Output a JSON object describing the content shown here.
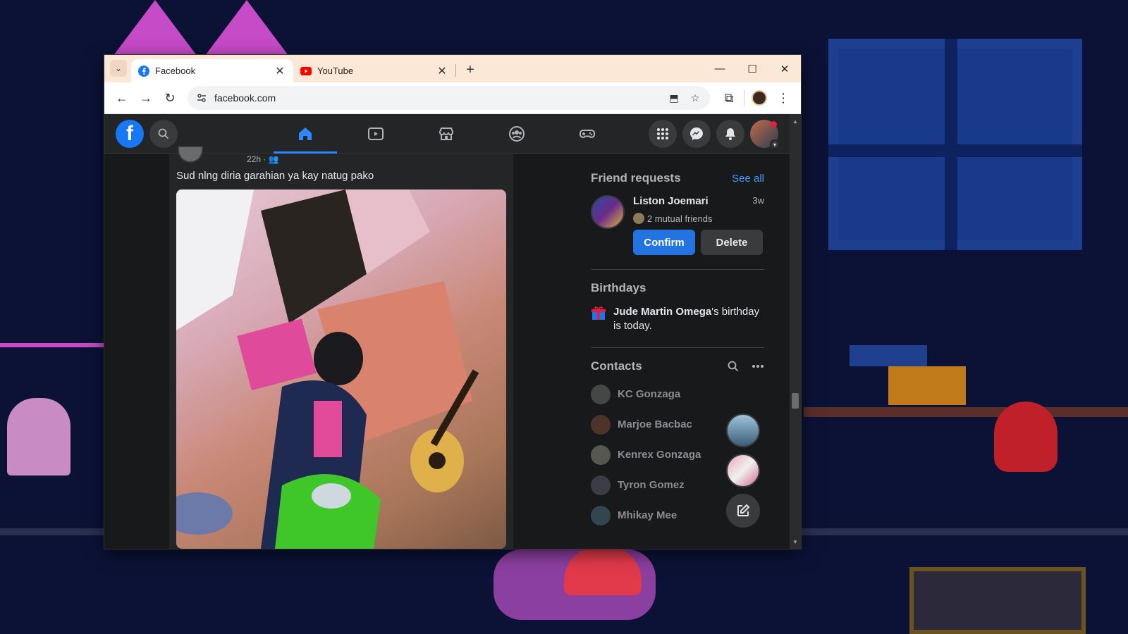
{
  "colors": {
    "fb_blue": "#1877f2",
    "fb_dark": "#18191a",
    "fb_card": "#242526",
    "confirm_blue": "#2374e1",
    "tab_strip": "#fbe8d6"
  },
  "browser": {
    "tabs": [
      {
        "label": "Facebook",
        "icon": "facebook-favicon-icon",
        "active": true
      },
      {
        "label": "YouTube",
        "icon": "youtube-favicon-icon",
        "active": false
      }
    ],
    "url": "facebook.com"
  },
  "fb": {
    "nav": [
      "home-icon",
      "watch-icon",
      "marketplace-icon",
      "groups-icon",
      "gaming-icon"
    ],
    "post": {
      "time": "22h ·",
      "caption": "Sud nlng diria garahian ya kay natug pako"
    },
    "friend_requests": {
      "title": "Friend requests",
      "see_all": "See all",
      "request": {
        "name": "Liston Joemari",
        "time": "3w",
        "mutual": "2 mutual friends",
        "confirm": "Confirm",
        "delete": "Delete"
      }
    },
    "birthdays": {
      "title": "Birthdays",
      "name": "Jude Martin Omega",
      "suffix": "'s birthday is today."
    },
    "contacts": {
      "title": "Contacts",
      "items": [
        {
          "name": "KC Gonzaga",
          "color": "#6b6b6b"
        },
        {
          "name": "Marjoe Bacbac",
          "color": "#7a4a3a"
        },
        {
          "name": "Kenrex Gonzaga",
          "color": "#8a8a7a"
        },
        {
          "name": "Tyron Gomez",
          "color": "#5a5a6a"
        },
        {
          "name": "Mhikay Mee",
          "color": "#4a6a7a"
        }
      ]
    }
  }
}
